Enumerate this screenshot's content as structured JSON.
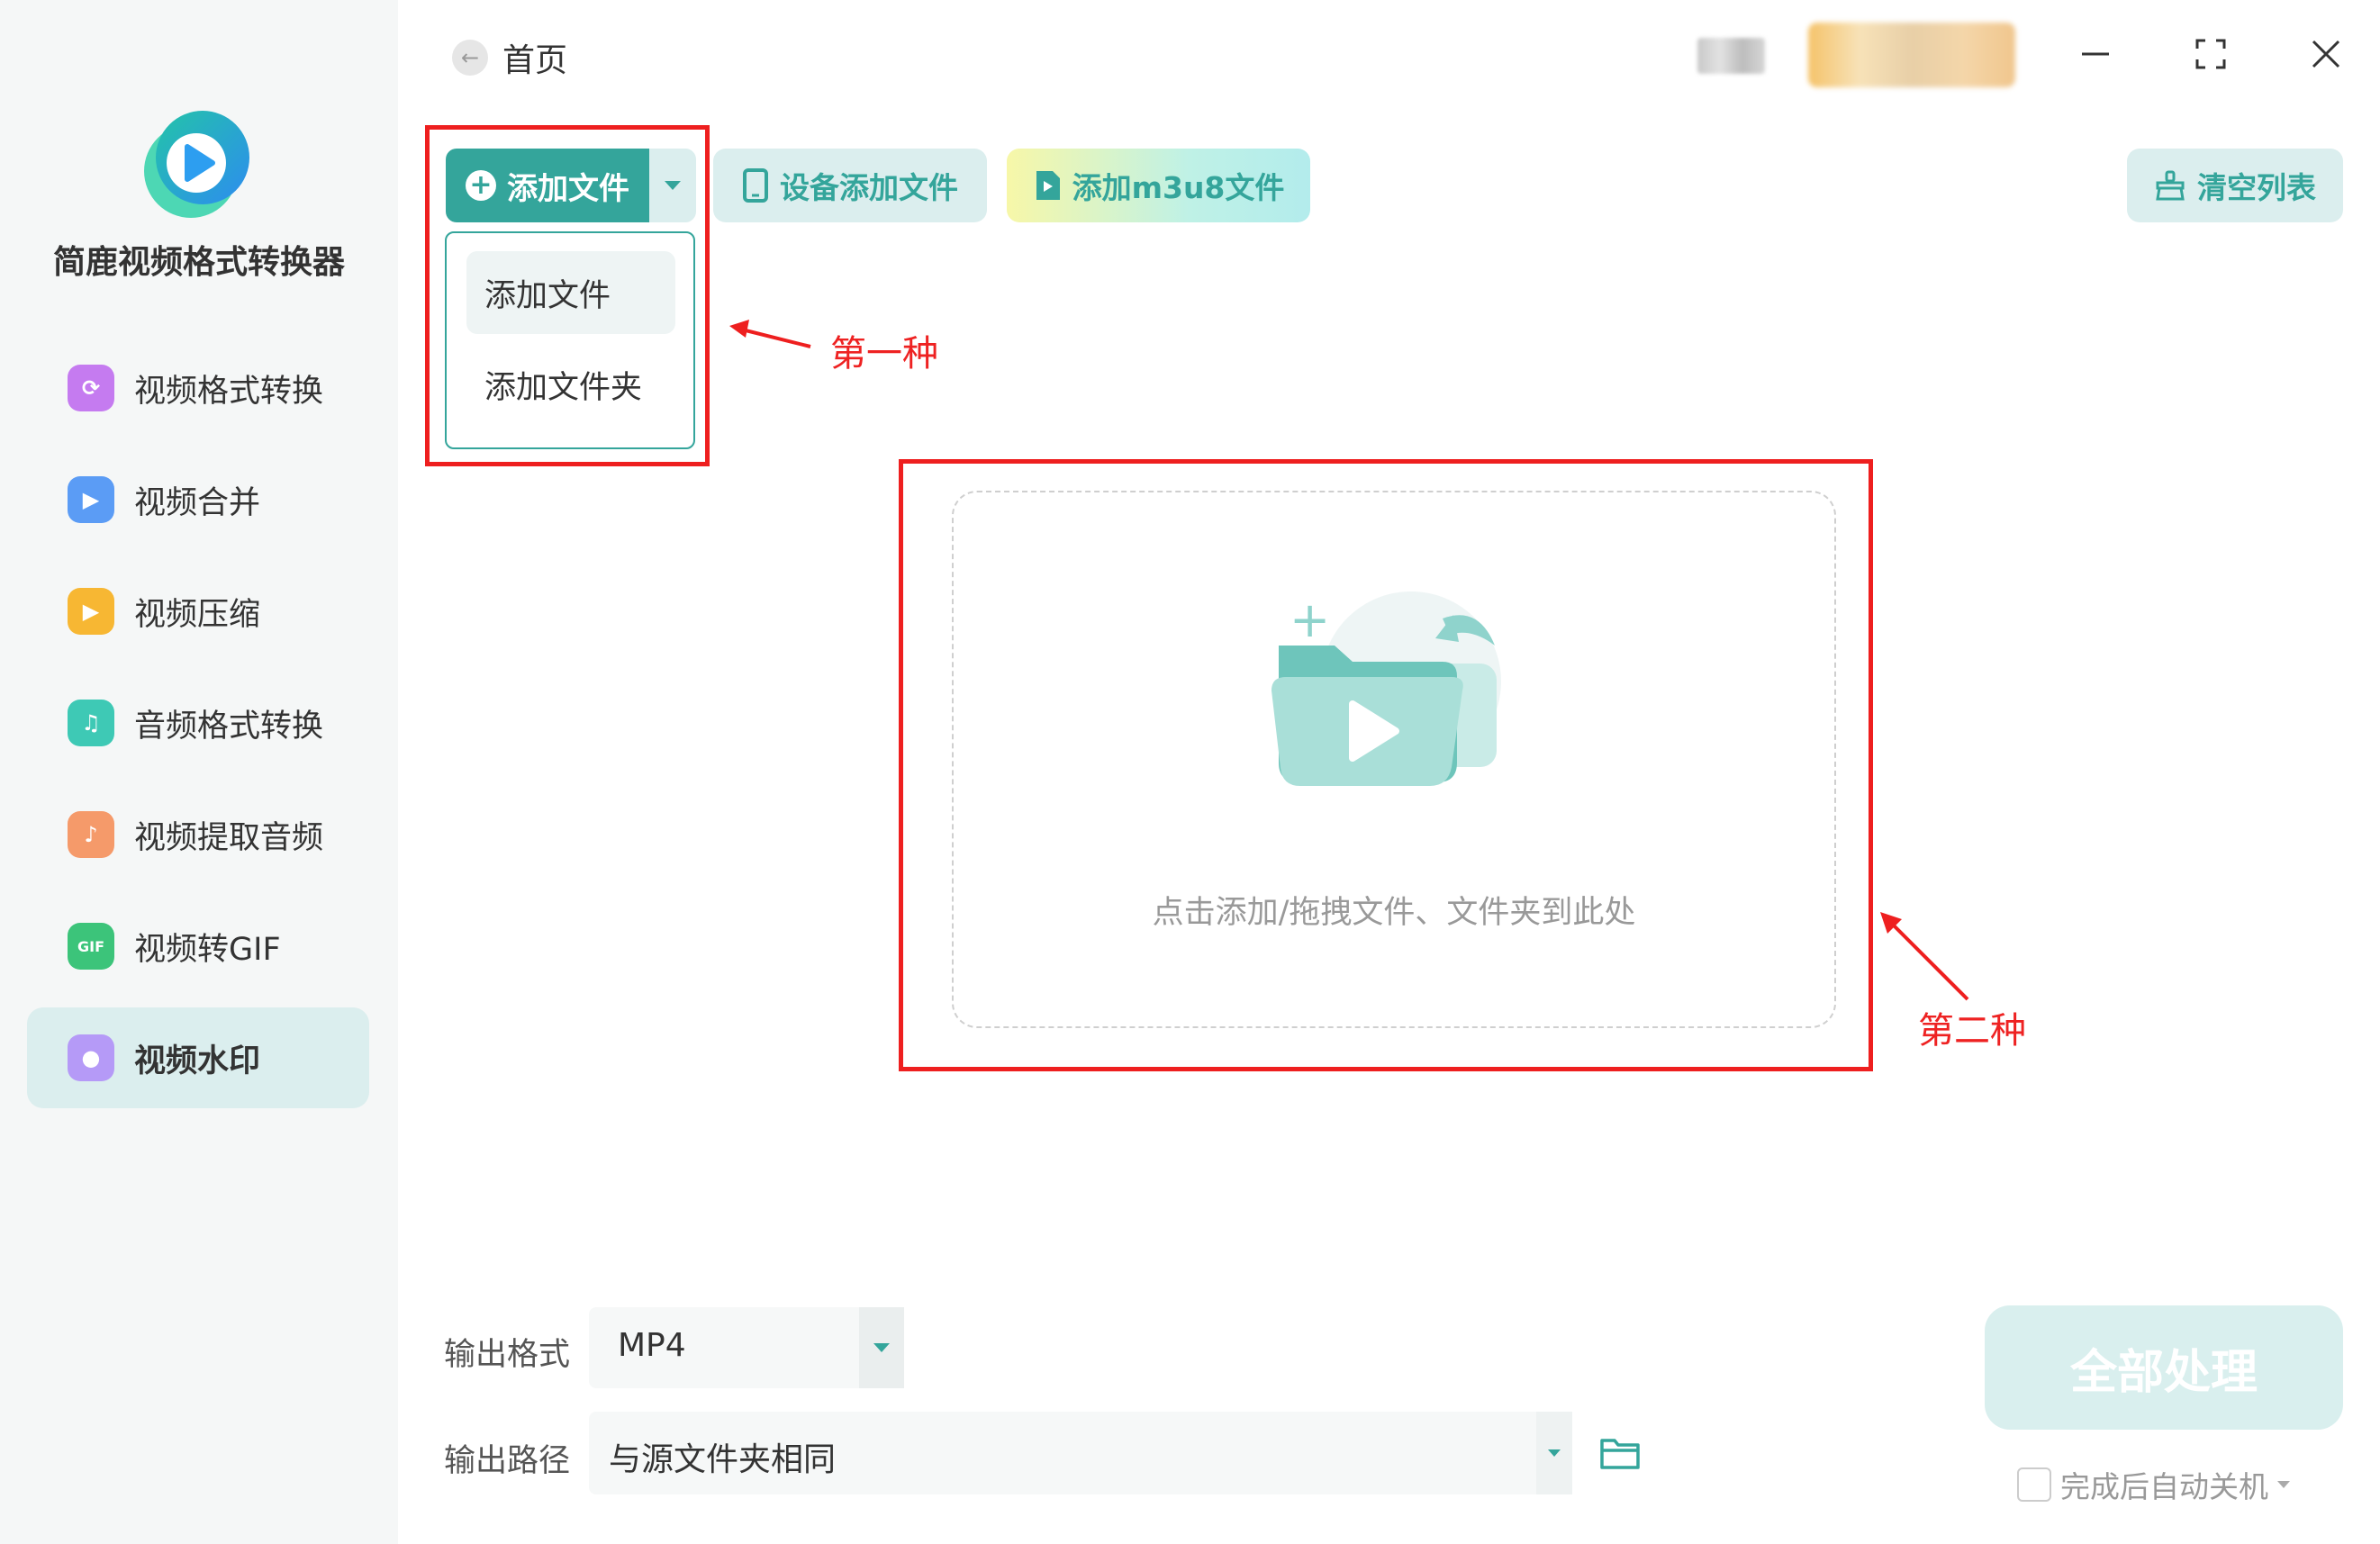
{
  "app": {
    "name": "简鹿视频格式转换器"
  },
  "sidebar": {
    "items": [
      {
        "label": "视频格式转换",
        "icon": "video-convert-icon",
        "color": "#c57bf0"
      },
      {
        "label": "视频合并",
        "icon": "video-merge-icon",
        "color": "#5b9cf5"
      },
      {
        "label": "视频压缩",
        "icon": "video-compress-icon",
        "color": "#f7b733"
      },
      {
        "label": "音频格式转换",
        "icon": "audio-convert-icon",
        "color": "#3ec9b5"
      },
      {
        "label": "视频提取音频",
        "icon": "extract-audio-icon",
        "color": "#f59a6a"
      },
      {
        "label": "视频转GIF",
        "icon": "gif-icon",
        "color": "#3cc47a"
      },
      {
        "label": "视频水印",
        "icon": "watermark-icon",
        "color": "#b59af7"
      }
    ],
    "active_index": 6
  },
  "header": {
    "back_label": "首页"
  },
  "toolbar": {
    "add_file": "添加文件",
    "device_add": "设备添加文件",
    "add_m3u8": "添加m3u8文件",
    "clear_list": "清空列表"
  },
  "dropdown": {
    "items": [
      "添加文件",
      "添加文件夹"
    ]
  },
  "annotations": {
    "first": "第一种",
    "second": "第二种"
  },
  "dropzone": {
    "text": "点击添加/拖拽文件、文件夹到此处"
  },
  "output": {
    "format_label": "输出格式",
    "format_value": "MP4",
    "path_label": "输出路径",
    "path_value": "与源文件夹相同"
  },
  "actions": {
    "process_all": "全部处理",
    "auto_shutdown": "完成后自动关机"
  },
  "colors": {
    "accent": "#34a59b",
    "accent_light": "#dbeeee",
    "annotation_red": "#ee1f1f"
  }
}
